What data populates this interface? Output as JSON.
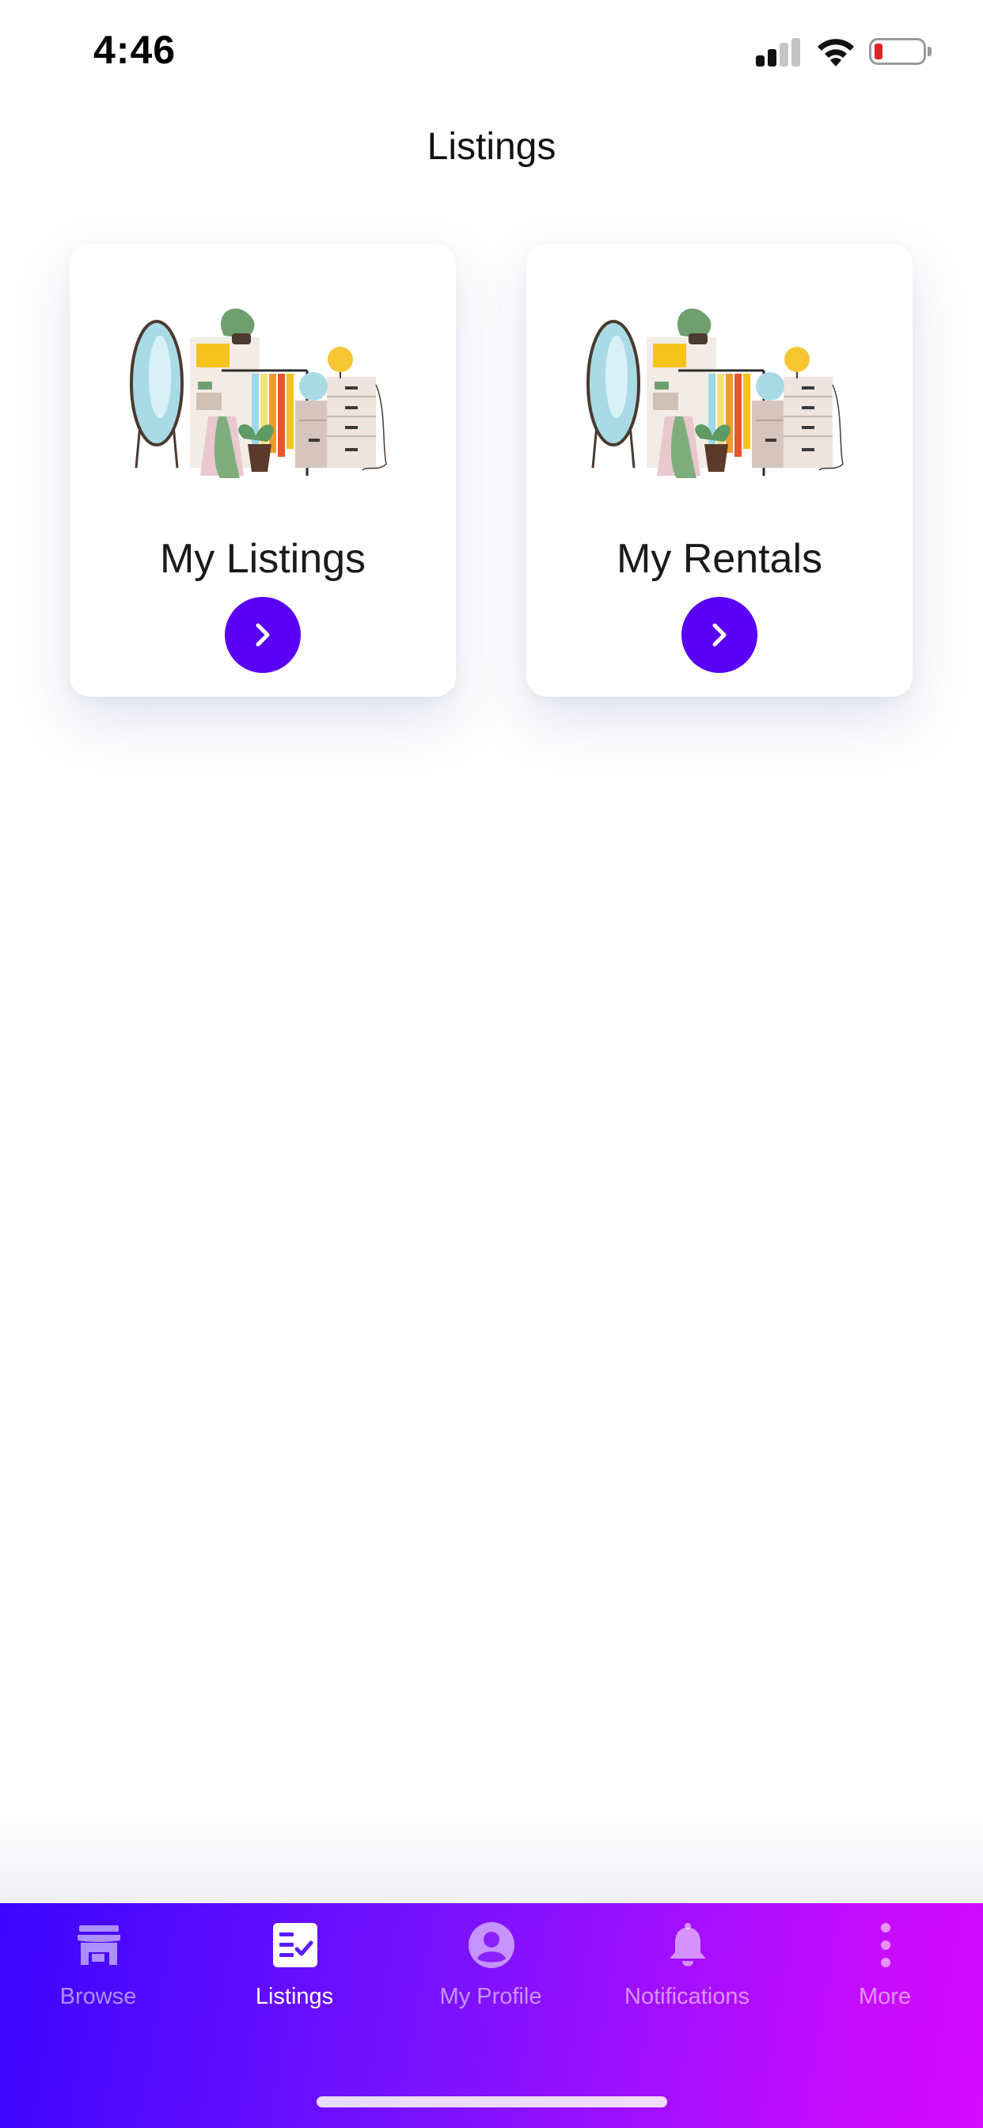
{
  "status_bar": {
    "time": "4:46",
    "icons": [
      "cellular-signal-icon",
      "wifi-icon",
      "battery-low-icon"
    ],
    "battery_level_color": "#e0242a"
  },
  "header": {
    "title": "Listings"
  },
  "cards": [
    {
      "label": "My Listings",
      "illustration": "wardrobe-illustration",
      "action_icon": "chevron-right-icon"
    },
    {
      "label": "My Rentals",
      "illustration": "wardrobe-illustration",
      "action_icon": "chevron-right-icon"
    }
  ],
  "colors": {
    "accent": "#5a00f5",
    "tab_gradient_start": "#3a05ff",
    "tab_gradient_end": "#d60aff"
  },
  "tab_bar": {
    "active": "Listings",
    "tabs": [
      {
        "label": "Browse",
        "icon": "storefront-icon"
      },
      {
        "label": "Listings",
        "icon": "checklist-icon"
      },
      {
        "label": "My Profile",
        "icon": "account-circle-icon"
      },
      {
        "label": "Notifications",
        "icon": "bell-icon"
      },
      {
        "label": "More",
        "icon": "more-vertical-icon"
      }
    ]
  }
}
